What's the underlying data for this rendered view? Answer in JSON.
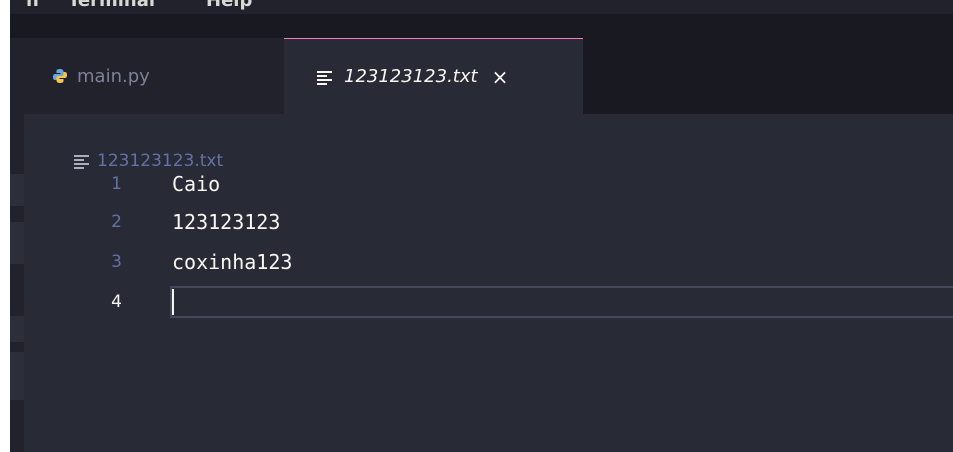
{
  "menubar": {
    "items": [
      "n",
      "Terminal",
      "Help"
    ]
  },
  "tabs": [
    {
      "label": "main.py",
      "icon": "python-file-icon",
      "active": false
    },
    {
      "label": "123123123.txt",
      "icon": "text-file-icon",
      "active": true,
      "close": "×"
    }
  ],
  "breadcrumb": {
    "icon": "text-file-icon",
    "label": "123123123.txt"
  },
  "editor": {
    "lines": [
      {
        "number": "1",
        "text": "Caio"
      },
      {
        "number": "2",
        "text": "123123123"
      },
      {
        "number": "3",
        "text": "coxinha123"
      },
      {
        "number": "4",
        "text": ""
      }
    ],
    "current_line": "4"
  },
  "colors": {
    "background": "#282a36",
    "tab_bar": "#191a21",
    "foreground": "#f8f8f2",
    "comment": "#6272a4",
    "accent": "#ff79c6"
  }
}
